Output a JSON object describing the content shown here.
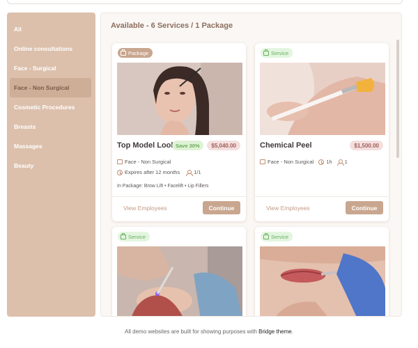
{
  "sidebar": {
    "items": [
      {
        "label": "All"
      },
      {
        "label": "Online consultations"
      },
      {
        "label": "Face - Surgical"
      },
      {
        "label": "Face - Non Surgical"
      },
      {
        "label": "Cosmetic Procedures"
      },
      {
        "label": "Breasts"
      },
      {
        "label": "Massages"
      },
      {
        "label": "Beauty"
      }
    ]
  },
  "main": {
    "heading": "Available - 6 Services / 1 Package",
    "cards": [
      {
        "badge": "Package",
        "photo_icon": "woman-brow-brush-photo",
        "title": "Top Model Look",
        "save": "Save 30%",
        "price": "$5,040.00",
        "category": "Face - Non Surgical",
        "expires": "Expires after 12 months",
        "capacity": "1/1",
        "in_package": "In Package: Brow Lift • Facelift • Lip Fillers",
        "view_label": "View Employees",
        "continue_label": "Continue"
      },
      {
        "badge": "Service",
        "photo_icon": "brush-on-skin-photo",
        "title": "Chemical Peel",
        "price": "$1,500.00",
        "category": "Face - Non Surgical",
        "duration": "1h",
        "capacity": "1",
        "view_label": "View Employees",
        "continue_label": "Continue"
      },
      {
        "badge": "Service",
        "photo_icon": "facial-treatment-photo"
      },
      {
        "badge": "Service",
        "photo_icon": "lip-injection-photo"
      }
    ]
  },
  "footer": {
    "text": "All demo websites are built for showing purposes with ",
    "brand": "Bridge theme",
    "end": "."
  },
  "colors": {
    "sidebar_bg": "#dcc0ac",
    "accent": "#c9a68f",
    "service_badge": "#e3f5df",
    "price_badge": "#f4dfdf"
  }
}
